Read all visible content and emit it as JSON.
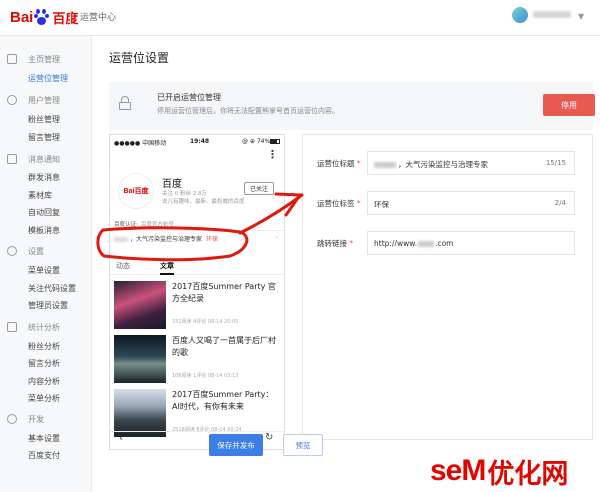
{
  "colors": {
    "accent": "#2f7bd8",
    "danger": "#e75a52",
    "brand_red": "#e10601",
    "primary": "#3d7ee6"
  },
  "topbar": {
    "logo_latin": "Bai",
    "logo_cn": "百度",
    "system_title": "运营中心"
  },
  "sidebar": {
    "groups": [
      {
        "title": "主页管理",
        "icon": "home-icon",
        "items": [
          {
            "label": "运营位管理",
            "active": true
          }
        ]
      },
      {
        "title": "用户管理",
        "icon": "user-icon",
        "items": [
          {
            "label": "粉丝管理"
          },
          {
            "label": "留言管理"
          }
        ]
      },
      {
        "title": "消息通知",
        "icon": "mail-icon",
        "items": [
          {
            "label": "群发消息"
          },
          {
            "label": "素材库"
          },
          {
            "label": "自动回复"
          },
          {
            "label": "模板消息"
          }
        ]
      },
      {
        "title": "设置",
        "icon": "settings-icon",
        "items": [
          {
            "label": "菜单设置"
          },
          {
            "label": "关注代码设置"
          },
          {
            "label": "管理员设置"
          }
        ]
      },
      {
        "title": "统计分析",
        "icon": "stats-icon",
        "items": [
          {
            "label": "粉丝分析"
          },
          {
            "label": "留言分析"
          },
          {
            "label": "内容分析"
          },
          {
            "label": "菜单分析"
          }
        ]
      },
      {
        "title": "开发",
        "icon": "dev-icon",
        "items": [
          {
            "label": "基本设置"
          },
          {
            "label": "百度支付"
          }
        ]
      }
    ]
  },
  "main": {
    "page_title": "运营位设置",
    "notice": {
      "title": "已开启运营位管理",
      "desc": "停用运营位管理后，你将无法配置熊掌号首页运营位内容。",
      "stop_button": "停用"
    },
    "phone": {
      "status_left": "●●●●● 中国移动 ",
      "status_time": "19:48",
      "status_right": "@ ⊕ 74%",
      "name": "百度",
      "logo_text": "Bai百度",
      "stats": "关注 0   粉丝 2.8万",
      "intro": "说儿有趣味，最新、最权威的百度",
      "follow_button": "已关注",
      "auth_label": "百度认证:",
      "auth_value": "百度官方帐号",
      "ops_text": "，大气污染监控与治理专家",
      "ops_tag": "环保",
      "tabs": [
        "动态",
        "文章"
      ],
      "articles": [
        {
          "title": "2017百度Summer Party 官方全纪录",
          "meta": "332阅读  4评论  08-14 20:00"
        },
        {
          "title": "百度人又喝了一首属于后厂村的歌",
          "meta": "106阅读  1评论  08-14 03:13"
        },
        {
          "title": "2017百度Summer Party：AI时代，有你有未来",
          "meta": "2518阅读  8评论  08-14 00:24"
        }
      ]
    },
    "form": {
      "fields": [
        {
          "label": "运营位标题",
          "value": "，大气污染监控与治理专家",
          "count": "15/15"
        },
        {
          "label": "运营位标签",
          "value": "环保",
          "count": "2/4"
        },
        {
          "label": "跳转链接",
          "value": "http://www.",
          "value_tail": ".com",
          "count": ""
        }
      ]
    },
    "save_button": "保存并发布",
    "preview_button": "预览"
  },
  "watermark": {
    "latin": "seM",
    "cn": "优化网"
  }
}
